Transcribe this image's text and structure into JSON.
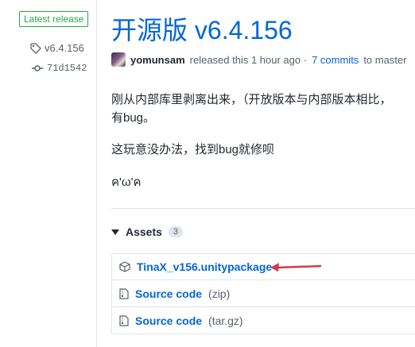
{
  "sidebar": {
    "badge": "Latest release",
    "tag": "v6.4.156",
    "commit": "71d1542"
  },
  "release": {
    "title": "开源版 v6.4.156",
    "author": "yomunsam",
    "released_text": "released this 1 hour ago ·",
    "commits_link": "7 commits",
    "commits_suffix": "to master",
    "body": [
      "刚从内部库里剥离出来，（开放版本与内部版本相比，",
      "有bug。",
      "这玩意没办法，找到bug就修呗",
      "ค'ω'ค"
    ]
  },
  "assets": {
    "label": "Assets",
    "count": "3",
    "items": [
      {
        "name": "TinaX_v156.unitypackage",
        "ext": "",
        "icon": "package-icon"
      },
      {
        "name": "Source code",
        "ext": "(zip)",
        "icon": "file-zip-icon"
      },
      {
        "name": "Source code",
        "ext": "(tar.gz)",
        "icon": "file-zip-icon"
      }
    ]
  },
  "colors": {
    "link": "#0366d6",
    "badge": "#28a745",
    "annotation_arrow": "#d73a49"
  }
}
